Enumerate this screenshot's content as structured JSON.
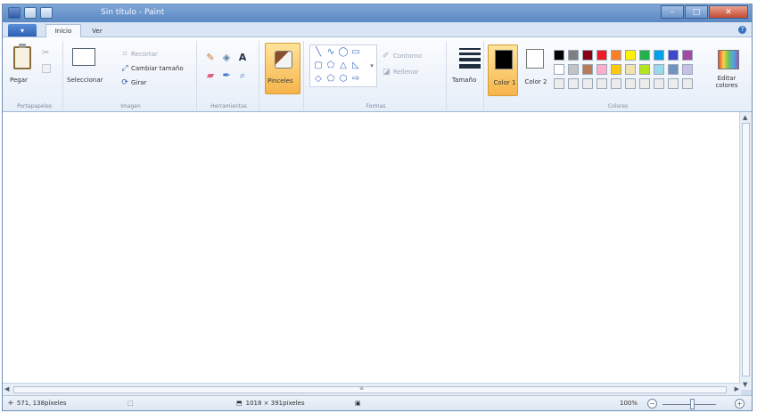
{
  "window": {
    "title": "Sin título - Paint",
    "controls": [
      "minimize-icon",
      "maximize-icon",
      "close-icon"
    ]
  },
  "quick_access": [
    "save-icon",
    "undo-icon",
    "redo-icon"
  ],
  "tabs": {
    "file_label": "▾",
    "items": [
      {
        "label": "Inicio",
        "active": true
      },
      {
        "label": "Ver",
        "active": false
      }
    ],
    "help_label": "?"
  },
  "ribbon": {
    "clipboard": {
      "paste_label": "Pegar",
      "group_label": "Portapapeles"
    },
    "image": {
      "select_label": "Seleccionar",
      "crop_label": "Recortar",
      "resize_label": "Cambiar tamaño",
      "rotate_label": "Girar",
      "group_label": "Imagen"
    },
    "tools": {
      "items": [
        "pencil-icon",
        "fill-icon",
        "text-icon",
        "eraser-icon",
        "color-picker-icon",
        "magnifier-icon"
      ],
      "group_label": "Herramientas"
    },
    "brushes": {
      "label": "Pinceles"
    },
    "shapes": {
      "outline_label": "Contorno",
      "fill_label": "Rellenar",
      "group_label": "Formas"
    },
    "size": {
      "label": "Tamaño"
    },
    "colors": {
      "color1_label": "Color 1",
      "color2_label": "Color 2",
      "color1": "#000000",
      "color2": "#ffffff",
      "edit_label": "Editar colores",
      "group_label": "Colores",
      "palette": [
        "#000000",
        "#7f7f7f",
        "#880015",
        "#ed1c24",
        "#ff7f27",
        "#fff200",
        "#22b14c",
        "#00a2e8",
        "#3f48cc",
        "#a349a4",
        "#ffffff",
        "#c3c3c3",
        "#b97a57",
        "#ffaec9",
        "#ffc90e",
        "#efe4b0",
        "#b5e61d",
        "#99d9ea",
        "#7092be",
        "#c8bfe7",
        "#ececec",
        "#ececec",
        "#ececec",
        "#ececec",
        "#ececec",
        "#ececec",
        "#ececec",
        "#ececec",
        "#ececec",
        "#ececec"
      ]
    }
  },
  "status": {
    "cursor": "571, 138píxeles",
    "dimensions": "1018 × 391píxeles",
    "zoom": "100%"
  }
}
